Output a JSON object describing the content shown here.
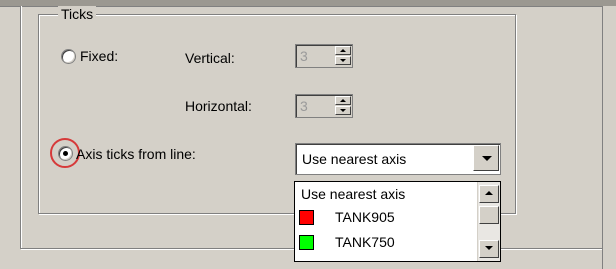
{
  "ticks_group": {
    "title": "Ticks",
    "fixed_label": "Fixed:",
    "vertical_label": "Vertical:",
    "horizontal_label": "Horizontal:",
    "vertical_value": "3",
    "horizontal_value": "3",
    "axis_ticks_label": "Axis ticks from line:",
    "selected_option": "Use nearest axis"
  },
  "dropdown": {
    "items": [
      {
        "label": "Use nearest axis"
      },
      {
        "label": "TANK905",
        "color": "#ff0000"
      },
      {
        "label": "TANK750",
        "color": "#00ff00"
      }
    ]
  },
  "colors": {
    "highlight_ring": "#d63a3a",
    "dialog_bg": "#d4d0c8"
  }
}
